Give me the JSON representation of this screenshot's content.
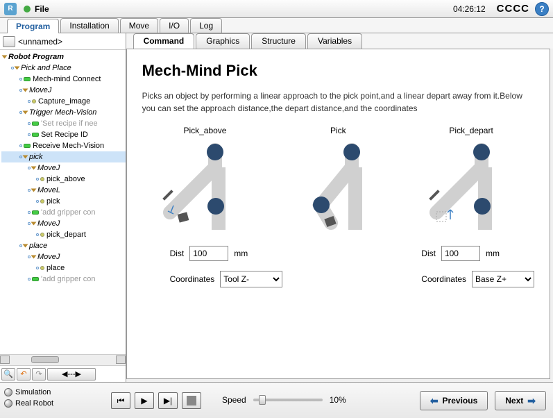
{
  "topbar": {
    "file": "File",
    "time": "04:26:12",
    "cccc": "CCCC"
  },
  "main_tabs": [
    "Program",
    "Installation",
    "Move",
    "I/O",
    "Log"
  ],
  "main_tab_active": 0,
  "sidebar": {
    "title": "<unnamed>"
  },
  "tree": [
    {
      "d": 0,
      "icon": "tri",
      "text": "Robot Program",
      "cls": "bold ital"
    },
    {
      "d": 1,
      "icon": "tri",
      "text": "Pick and Place",
      "cls": "ital",
      "conn": true
    },
    {
      "d": 2,
      "icon": "grn",
      "text": "Mech-mind Connect",
      "conn": true
    },
    {
      "d": 2,
      "icon": "tri",
      "text": "MoveJ",
      "cls": "ital",
      "conn": true
    },
    {
      "d": 3,
      "icon": "dot",
      "text": "Capture_image",
      "conn": true
    },
    {
      "d": 2,
      "icon": "tri",
      "text": "Trigger Mech-Vision",
      "cls": "ital",
      "conn": true
    },
    {
      "d": 3,
      "icon": "grn",
      "text": "'Set recipe if nee",
      "cls": "gray",
      "conn": true
    },
    {
      "d": 3,
      "icon": "grn",
      "text": "Set Recipe ID",
      "conn": true
    },
    {
      "d": 2,
      "icon": "grn",
      "text": "Receive Mech-Vision",
      "conn": true
    },
    {
      "d": 2,
      "icon": "tri",
      "text": "pick",
      "cls": "ital sel",
      "conn": true
    },
    {
      "d": 3,
      "icon": "tri",
      "text": "MoveJ",
      "cls": "ital",
      "conn": true
    },
    {
      "d": 4,
      "icon": "dot",
      "text": "pick_above",
      "conn": true
    },
    {
      "d": 3,
      "icon": "tri",
      "text": "MoveL",
      "cls": "ital",
      "conn": true
    },
    {
      "d": 4,
      "icon": "dot",
      "text": "pick",
      "conn": true
    },
    {
      "d": 3,
      "icon": "grn",
      "text": "'add gripper con",
      "cls": "gray",
      "conn": true
    },
    {
      "d": 3,
      "icon": "tri",
      "text": "MoveJ",
      "cls": "ital",
      "conn": true
    },
    {
      "d": 4,
      "icon": "dot",
      "text": "pick_depart",
      "conn": true
    },
    {
      "d": 2,
      "icon": "tri",
      "text": "place",
      "cls": "ital",
      "conn": true
    },
    {
      "d": 3,
      "icon": "tri",
      "text": "MoveJ",
      "cls": "ital",
      "conn": true
    },
    {
      "d": 4,
      "icon": "dot",
      "text": "place",
      "conn": true
    },
    {
      "d": 3,
      "icon": "grn",
      "text": "'add gripper con",
      "cls": "gray",
      "conn": true
    }
  ],
  "sub_tabs": [
    "Command",
    "Graphics",
    "Structure",
    "Variables"
  ],
  "sub_tab_active": 0,
  "command": {
    "title": "Mech-Mind Pick",
    "desc": "Picks an object by performing a linear approach to the pick point,and a linear depart away from it.Below you can set the approach distance,the depart distance,and the coordinates",
    "diag_labels": [
      "Pick_above",
      "Pick",
      "Pick_depart"
    ],
    "dist_label": "Dist",
    "mm": "mm",
    "coord_label": "Coordinates",
    "approach": {
      "dist": "100",
      "coord": "Tool Z-"
    },
    "depart": {
      "dist": "100",
      "coord": "Base Z+"
    }
  },
  "footer": {
    "sim": "Simulation",
    "real": "Real Robot",
    "speed_label": "Speed",
    "speed_value": "10%",
    "prev": "Previous",
    "next": "Next"
  }
}
